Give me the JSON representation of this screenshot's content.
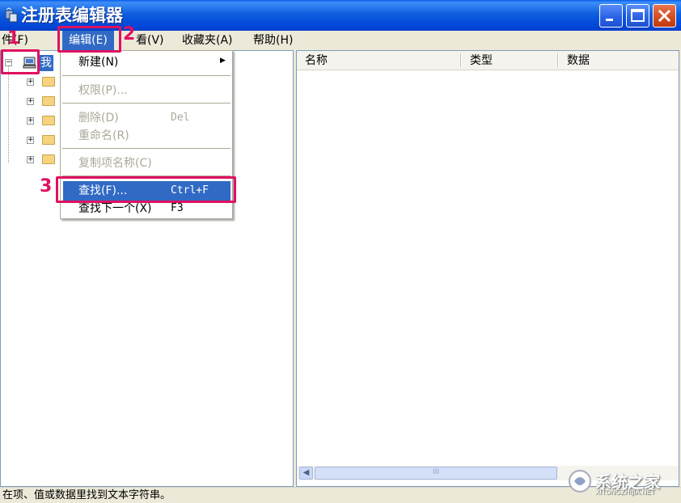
{
  "window": {
    "title": "注册表编辑器"
  },
  "menubar": {
    "file": "件(F)",
    "edit": "编辑(E)",
    "view": "看(V)",
    "favorites": "收藏夹(A)",
    "help": "帮助(H)"
  },
  "tree": {
    "root_label": "我"
  },
  "list": {
    "col_name": "名称",
    "col_type": "类型",
    "col_data": "数据",
    "hscroll_grip": "III"
  },
  "edit_menu": {
    "new": "新建(N)",
    "permissions": "权限(P)...",
    "delete": "删除(D)",
    "delete_shortcut": "Del",
    "rename": "重命名(R)",
    "copy_key_name": "复制项名称(C)",
    "find": "查找(F)...",
    "find_shortcut": "Ctrl+F",
    "find_next": "查找下一个(X)",
    "find_next_shortcut": "F3"
  },
  "status": {
    "text": "在项、值或数据里找到文本字符串。"
  },
  "annotations": {
    "step1": "1",
    "step2": "2",
    "step3": "3",
    "color": "#e0115f"
  },
  "watermark": {
    "text": "系统之家",
    "subtext": "XITONGZHIJIA.NET"
  },
  "colors": {
    "title_bar": "#0a5ee8",
    "highlight": "#316ac5",
    "close": "#d24a1d"
  }
}
